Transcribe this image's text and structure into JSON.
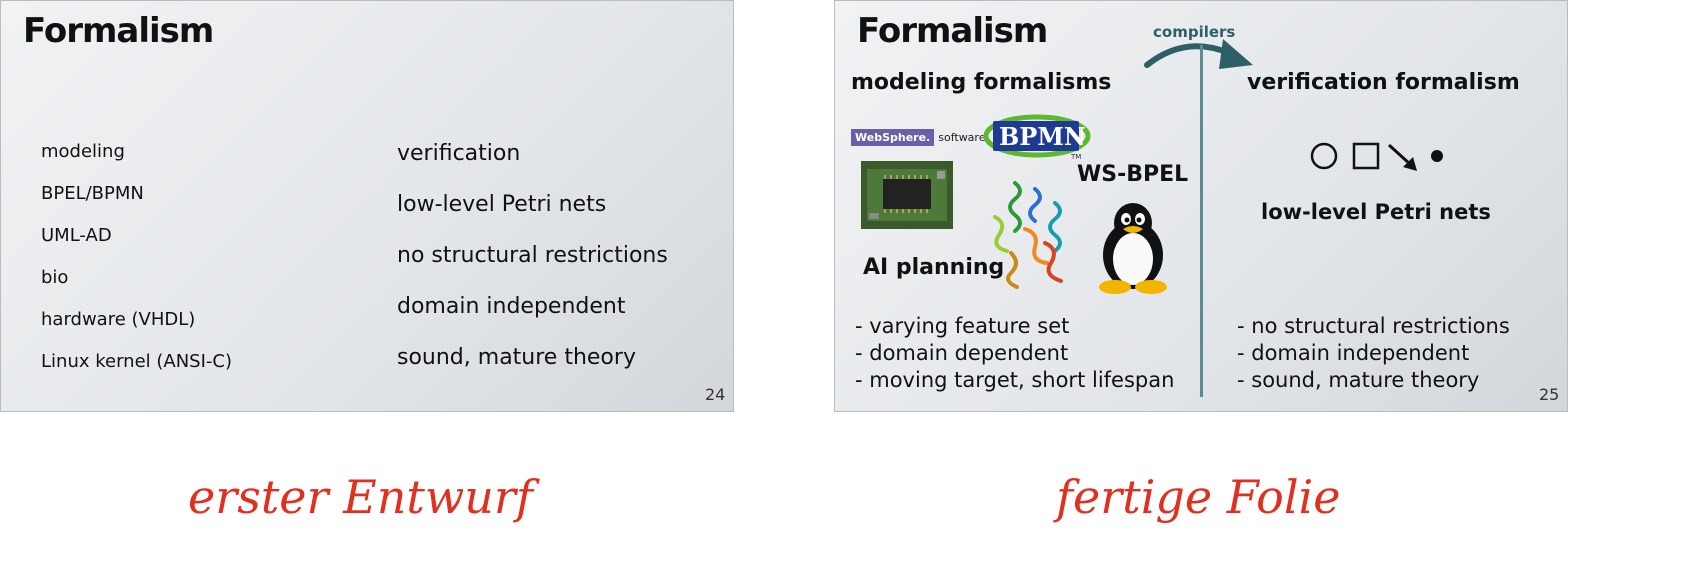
{
  "slide24": {
    "title": "Formalism",
    "page_number": "24",
    "left_items": [
      "modeling",
      "BPEL/BPMN",
      "UML-AD",
      "bio",
      "hardware (VHDL)",
      "Linux kernel (ANSI-C)"
    ],
    "right_items": [
      "verification",
      "low-level Petri nets",
      "no structural restrictions",
      "domain independent",
      "sound, mature theory"
    ]
  },
  "slide25": {
    "title": "Formalism",
    "arrow_label": "compilers",
    "left_header": "modeling formalisms",
    "right_header": "verification formalism",
    "websphere_brand": "WebSphere.",
    "websphere_software": "software",
    "bpmn_logo": "BPMN",
    "bpmn_tm": "TM",
    "ws_bpel": "WS-BPEL",
    "ai_planning": "AI planning",
    "petri_label": "low-level Petri nets",
    "left_bullets": [
      "- varying feature set",
      "- domain dependent",
      "- moving target, short lifespan"
    ],
    "right_bullets": [
      "- no structural restrictions",
      "- domain independent",
      "- sound, mature theory"
    ],
    "page_number": "25"
  },
  "captions": {
    "left": "erster Entwurf",
    "right": "fertige Folie"
  },
  "colors": {
    "caption": "#e1301f",
    "separator": "#5d8b92",
    "arrow": "#2f5f66",
    "bpmn_blue": "#1f3a93",
    "bpmn_green": "#5db82d",
    "websphere_purple": "#6b5fa8"
  }
}
